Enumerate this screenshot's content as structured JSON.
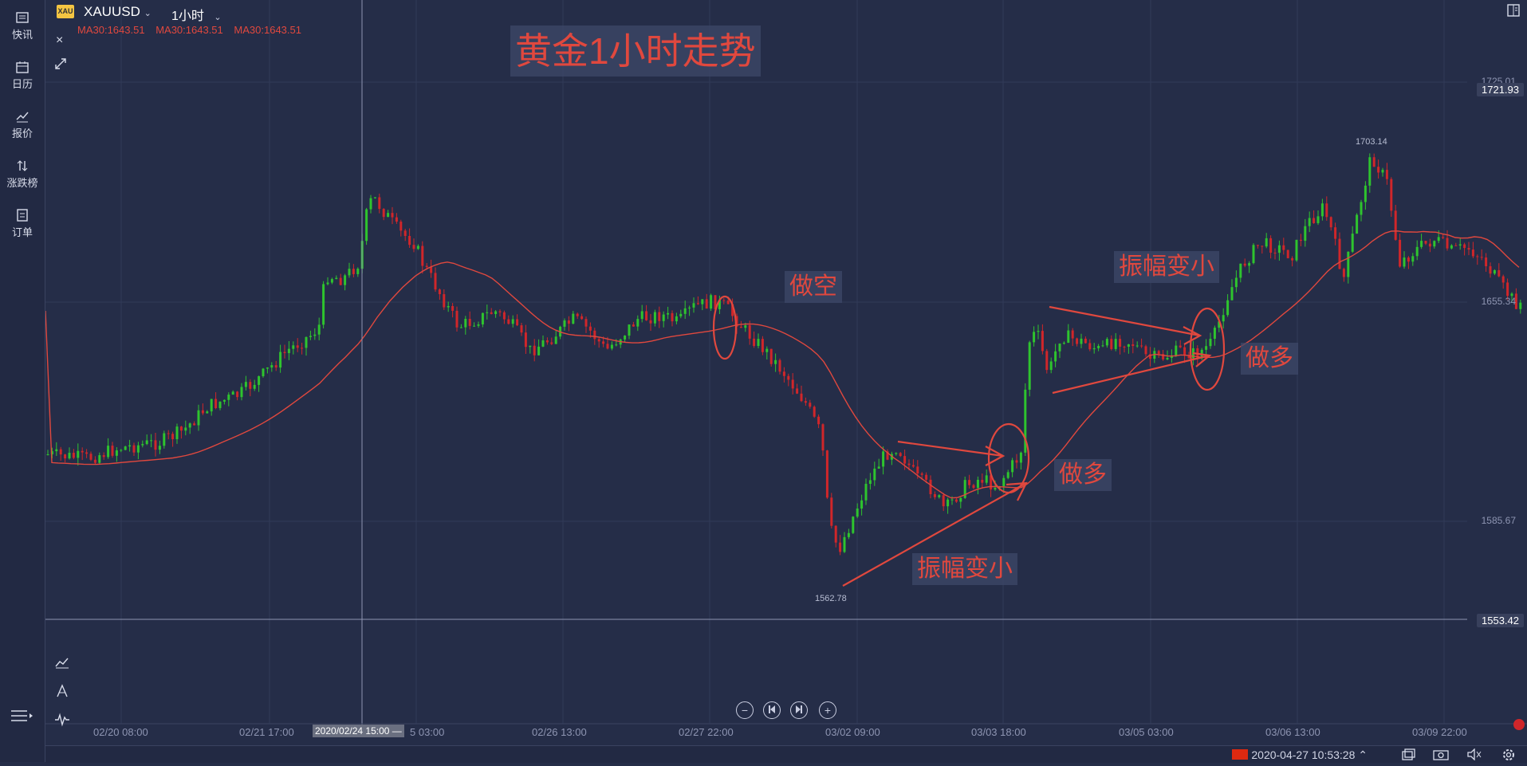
{
  "sidebar": {
    "items": [
      {
        "label": "快讯",
        "icon": "news-icon"
      },
      {
        "label": "日历",
        "icon": "calendar-icon"
      },
      {
        "label": "报价",
        "icon": "quote-chart-icon"
      },
      {
        "label": "涨跌榜",
        "icon": "updown-arrows-icon"
      },
      {
        "label": "订单",
        "icon": "order-icon"
      }
    ]
  },
  "header": {
    "symbol_badge": "XAU",
    "symbol": "XAUUSD",
    "timeframe": "1小时",
    "ma_labels": [
      "MA30:1643.51",
      "MA30:1643.51",
      "MA30:1643.51"
    ]
  },
  "annotations": {
    "title": "黄金1小时走势",
    "short_label": "做空",
    "long_label_1": "做多",
    "long_label_2": "做多",
    "narrow_label_1": "振幅变小",
    "narrow_label_2": "振幅变小"
  },
  "price_axis": {
    "labels": [
      "1725.01",
      "1655.34",
      "1585.67"
    ],
    "current_price": "1721.93",
    "crosshair_price": "1553.42"
  },
  "time_axis": {
    "labels": [
      "02/20 08:00",
      "02/21 17:00",
      "5 03:00",
      "02/26 13:00",
      "02/27 22:00",
      "03/02 09:00",
      "03/03 18:00",
      "03/05 03:00",
      "03/06 13:00",
      "03/09 22:00"
    ],
    "cursor_time": "2020/02/24 15:00 —"
  },
  "chart_extremes": {
    "high_label": "1703.14",
    "low_label": "1562.78"
  },
  "status_bar": {
    "datetime": "2020-04-27 10:53:28"
  },
  "colors": {
    "background": "#252d48",
    "up_candle": "#2ec42e",
    "down_candle": "#d0262a",
    "ma_line": "#e0483e"
  }
}
